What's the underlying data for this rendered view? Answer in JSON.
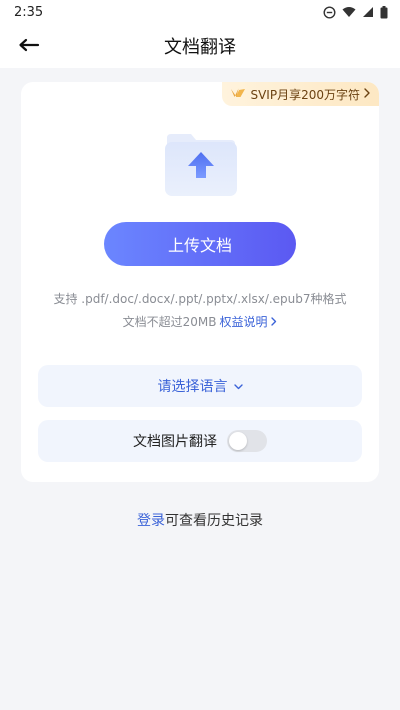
{
  "status_bar": {
    "time": "2:35"
  },
  "header": {
    "title": "文档翻译"
  },
  "svip_badge": {
    "label": "SVIP月享200万字符"
  },
  "upload": {
    "button_label": "上传文档"
  },
  "formats": {
    "supported_text": "支持 .pdf/.doc/.docx/.ppt/.pptx/.xlsx/.epub7种格式",
    "size_limit": "文档不超过20MB",
    "rights_link": "权益说明"
  },
  "language": {
    "placeholder": "请选择语言"
  },
  "image_translate": {
    "label": "文档图片翻译",
    "enabled": false
  },
  "history": {
    "login_link": "登录",
    "suffix": "可查看历史记录"
  },
  "colors": {
    "accent": "#3b63d8",
    "button_gradient_start": "#6b86ff",
    "button_gradient_end": "#5b59f2",
    "svip_text": "#6b4212"
  }
}
